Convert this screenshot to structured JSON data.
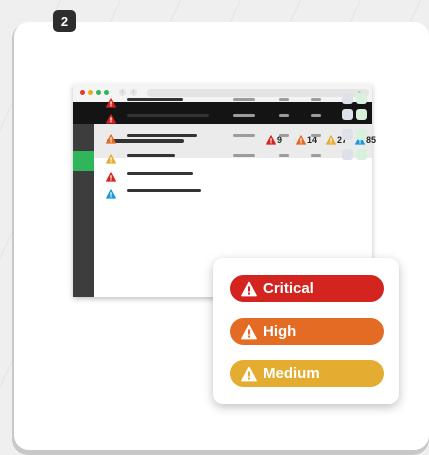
{
  "step_badge": "2",
  "colors": {
    "critical": "#d42420",
    "high": "#e36b24",
    "medium": "#e4ad32",
    "low": "#1a9bd8",
    "accent_green": "#2fb55a"
  },
  "browser": {
    "window_dots": [
      "#e03b32",
      "#f2a516",
      "#2fb55a"
    ],
    "nav_back_icon": "arrow-left-icon",
    "nav_forward_icon": "arrow-right-icon",
    "url_icon": "search-icon"
  },
  "summary_counts": [
    {
      "severity": "critical",
      "count": "9"
    },
    {
      "severity": "high",
      "count": "14"
    },
    {
      "severity": "medium",
      "count": "27"
    },
    {
      "severity": "low",
      "count": "85"
    }
  ],
  "rows": [
    {
      "severity": "critical"
    },
    {
      "severity": "critical"
    },
    {
      "severity": "high"
    },
    {
      "severity": "medium"
    },
    {
      "severity": "critical"
    },
    {
      "severity": "low"
    }
  ],
  "legend": {
    "items": [
      {
        "label": "Critical",
        "severity": "critical"
      },
      {
        "label": "High",
        "severity": "high"
      },
      {
        "label": "Medium",
        "severity": "medium"
      }
    ]
  }
}
